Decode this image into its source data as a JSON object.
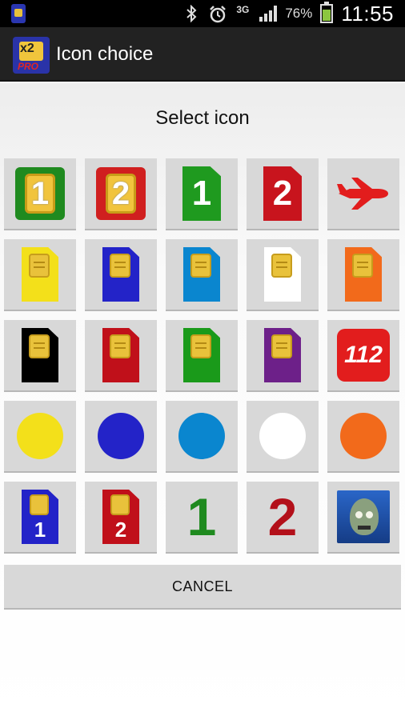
{
  "status_bar": {
    "battery_percent": "76%",
    "network": "3G",
    "time": "11:55",
    "icons": [
      "sim-app-icon",
      "bluetooth-icon",
      "alarm-icon",
      "3g-icon",
      "signal-icon",
      "battery-icon"
    ]
  },
  "action_bar": {
    "title": "Icon choice",
    "app_icon": {
      "badge_top": "x2",
      "badge_bottom": "PRO"
    }
  },
  "dialog": {
    "title": "Select icon",
    "cancel_label": "CANCEL"
  },
  "colors": {
    "green": "#1f8a1f",
    "red": "#d01f1f",
    "yellow": "#f3e01a",
    "blue": "#2323c8",
    "light_blue": "#0a86cf",
    "white": "#ffffff",
    "orange": "#f26a1b",
    "black": "#000000",
    "dark_red": "#c0101a",
    "purple": "#6d2089"
  },
  "icons": [
    {
      "name": "green-sim-1-icon",
      "label": "1"
    },
    {
      "name": "red-sim-2-icon",
      "label": "2"
    },
    {
      "name": "green-flag-1-icon",
      "label": "1"
    },
    {
      "name": "red-flag-2-icon",
      "label": "2"
    },
    {
      "name": "airplane-icon"
    },
    {
      "name": "yellow-sim-icon"
    },
    {
      "name": "blue-sim-icon"
    },
    {
      "name": "light-blue-sim-icon"
    },
    {
      "name": "white-sim-icon"
    },
    {
      "name": "orange-sim-icon"
    },
    {
      "name": "black-sim-icon"
    },
    {
      "name": "red-sim-icon"
    },
    {
      "name": "green-sim-icon"
    },
    {
      "name": "purple-sim-icon"
    },
    {
      "name": "emergency-112-icon",
      "label": "112"
    },
    {
      "name": "yellow-dot-icon"
    },
    {
      "name": "blue-dot-icon"
    },
    {
      "name": "light-blue-dot-icon"
    },
    {
      "name": "white-dot-icon"
    },
    {
      "name": "orange-dot-icon"
    },
    {
      "name": "blue-sim-number-1-icon",
      "label": "1"
    },
    {
      "name": "red-sim-number-2-icon",
      "label": "2"
    },
    {
      "name": "green-digit-1-icon",
      "label": "1"
    },
    {
      "name": "red-digit-2-icon",
      "label": "2"
    },
    {
      "name": "zombie-avatar-icon"
    }
  ]
}
